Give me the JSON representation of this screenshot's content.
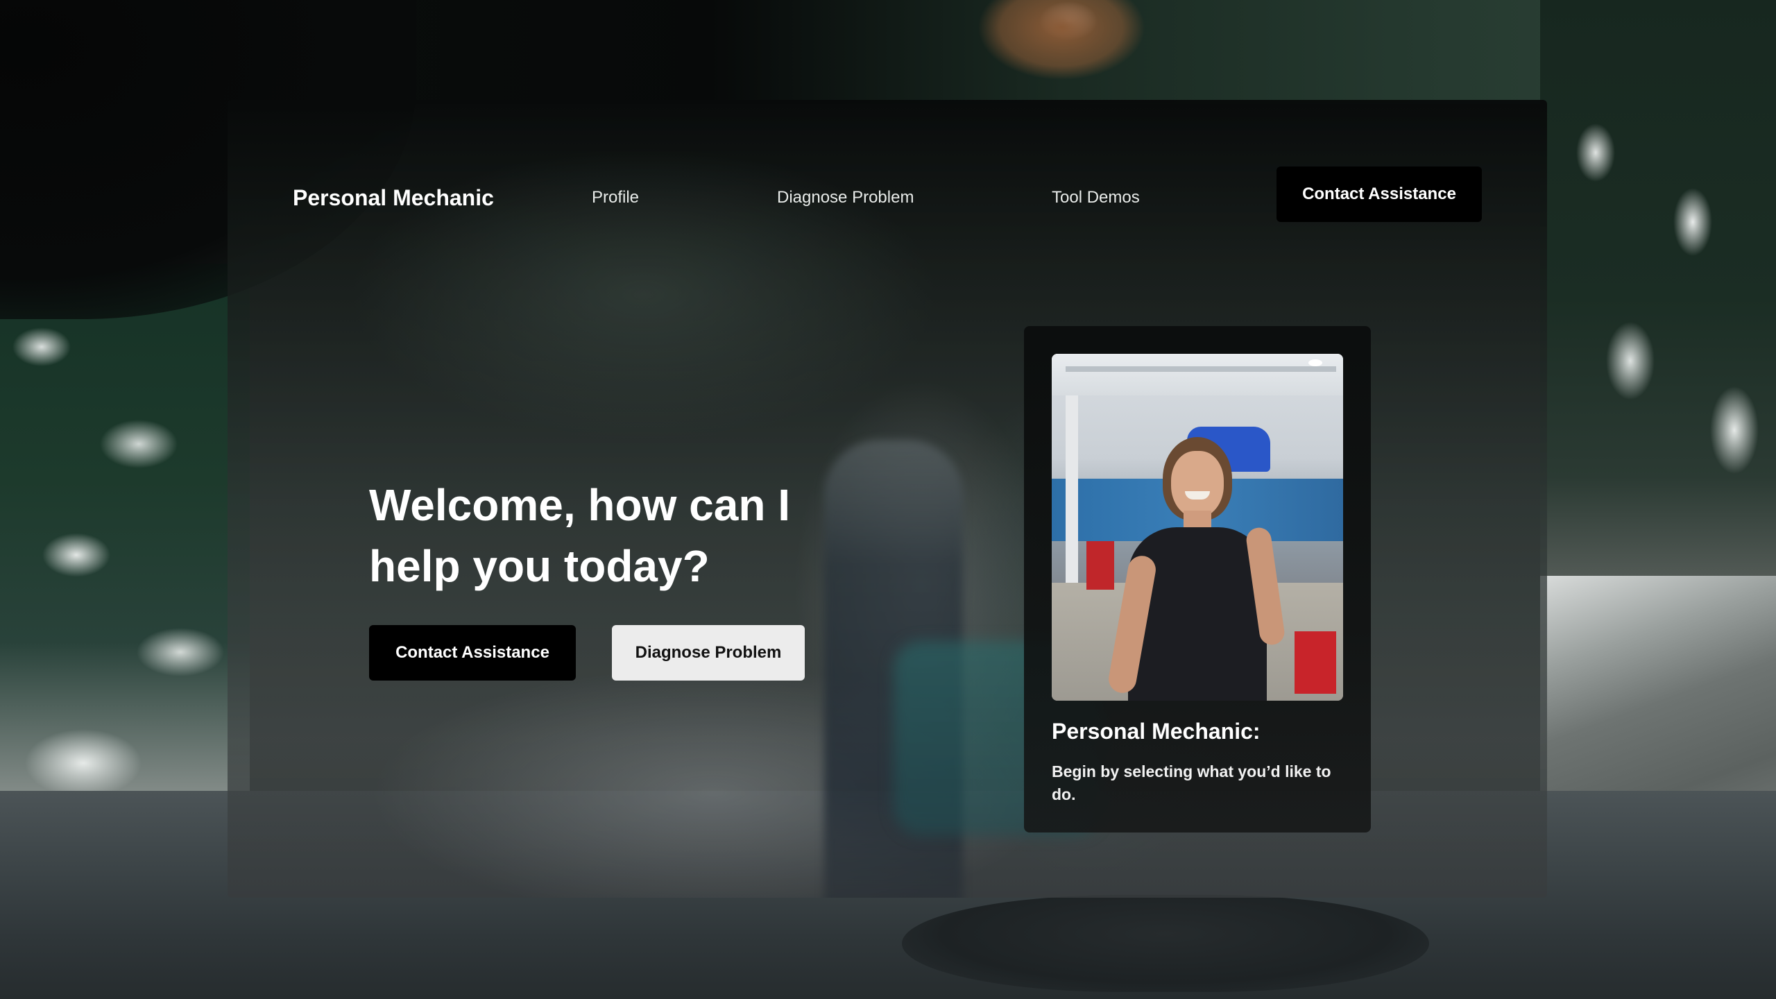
{
  "app": {
    "brand": "Personal Mechanic"
  },
  "nav": {
    "links": [
      {
        "label": "Profile"
      },
      {
        "label": "Diagnose Problem"
      },
      {
        "label": "Tool Demos"
      }
    ],
    "cta_label": "Contact Assistance"
  },
  "hero": {
    "title": "Welcome, how can I help you today?",
    "primary_button": "Contact Assistance",
    "secondary_button": "Diagnose Problem"
  },
  "card": {
    "title": "Personal Mechanic:",
    "description": "Begin by selecting what you’d like to do.",
    "photo": "mechanic-photo"
  },
  "colors": {
    "primary_button_bg": "#000000",
    "secondary_button_bg": "#ececec",
    "text_light": "#ffffff"
  }
}
